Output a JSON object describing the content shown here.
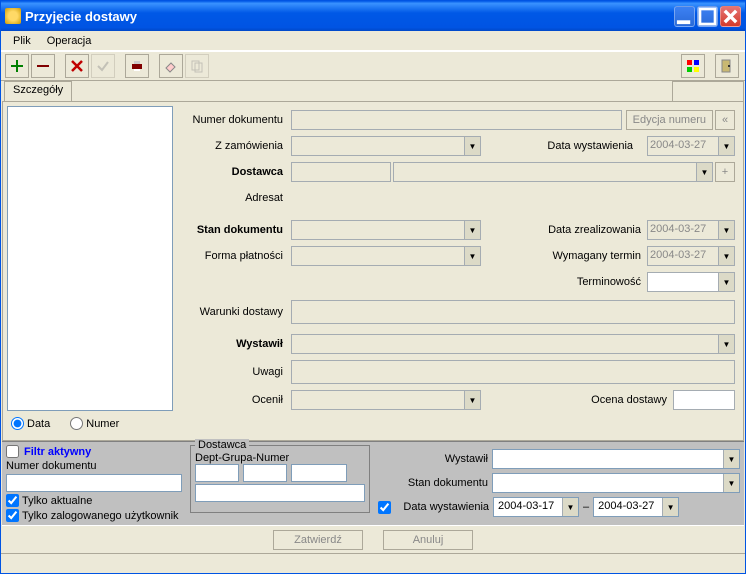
{
  "window": {
    "title": "Przyjęcie dostawy"
  },
  "menu": {
    "file": "Plik",
    "operation": "Operacja"
  },
  "tabs": {
    "details": "Szczegóły"
  },
  "form": {
    "numerDokumentu": "Numer dokumentu",
    "edycjaNumeru": "Edycja numeru",
    "zZamowienia": "Z zamówienia",
    "dataWystawienia": "Data wystawienia",
    "dataWystawieniaVal": "2004-03-27",
    "dostawca": "Dostawca",
    "adresat": "Adresat",
    "stanDokumentu": "Stan dokumentu",
    "formaPlatnosci": "Forma płatności",
    "dataZrealizowania": "Data zrealizowania",
    "dataZrealizowaniaVal": "2004-03-27",
    "wymaganyTermin": "Wymagany termin",
    "wymaganyTerminVal": "2004-03-27",
    "terminowosc": "Terminowość",
    "warunkiDostawy": "Warunki dostawy",
    "wystawil": "Wystawił",
    "uwagi": "Uwagi",
    "ocenil": "Ocenił",
    "ocenaDostawy": "Ocena dostawy"
  },
  "radios": {
    "data": "Data",
    "numer": "Numer"
  },
  "filter": {
    "header": "Filtr aktywny",
    "numerDokumentu": "Numer dokumentu",
    "tylkoAktualne": "Tylko aktualne",
    "tylkoZalogowanego": "Tylko zalogowanego użytkownik",
    "dostawca": "Dostawca",
    "deptGrupaNumer": "Dept-Grupa-Numer",
    "wystawil": "Wystawił",
    "stanDokumentu": "Stan dokumentu",
    "dataWystawienia": "Data wystawienia",
    "dateFrom": "2004-03-17",
    "dateTo": "2004-03-27",
    "dateSep": "–"
  },
  "buttons": {
    "zatwierdz": "Zatwierdź",
    "anuluj": "Anuluj"
  }
}
